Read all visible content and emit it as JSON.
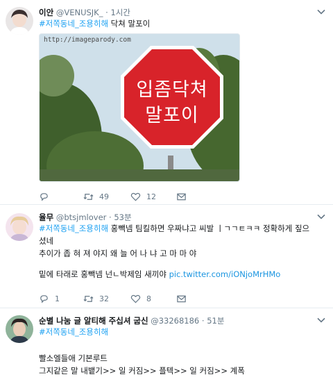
{
  "tweets": [
    {
      "name": "이안",
      "handle": "@VENUSJK_",
      "time": "1시간",
      "hashtag": "#저쪽동네_조용히해",
      "text": " 닥쳐 말포이",
      "image": {
        "watermark": "http://imageparody.com",
        "sign_line1": "입좀닥쳐",
        "sign_line2": "말포이"
      },
      "actions": {
        "reply": "",
        "retweet": "49",
        "like": "12"
      }
    },
    {
      "name": "율무",
      "handle": "@btsjmlover",
      "time": "53분",
      "hashtag": "#저쪽동네_조용히해",
      "line1": " 홍빽넴 팀킬하면 우짜냐고 씨발 ㅣㄱㄱㅌㅋㅋ 정확하게 짚으",
      "line2": "셨네",
      "line3": "추이가 좁 혀 져 야지 왜 늘 어 나 냐 고 마 마 야",
      "line4": "밑에 타래로 홍빽넴 넌ㄴ박제임 새끼야 ",
      "link": "pic.twitter.com/iONjoMrHMo",
      "actions": {
        "reply": "1",
        "retweet": "32",
        "like": "8"
      }
    },
    {
      "name": "순별 나눔 글 알티해 주십셔 굽신",
      "handle": "@33268186",
      "time": "51분",
      "hashtag": "#저쪽동네_조용히해",
      "line1": "빨소엘들애 기본루트",
      "line2": "그지같은 말 내뱉기>> 일 커짐>> 플텍>> 일 커짐>> 계폭"
    }
  ],
  "colors": {
    "accent": "#1da1f2",
    "muted": "#657786",
    "divider": "#e6ecf0"
  },
  "icons": [
    "reply-icon",
    "retweet-icon",
    "like-icon",
    "dm-icon",
    "caret-down-icon"
  ]
}
